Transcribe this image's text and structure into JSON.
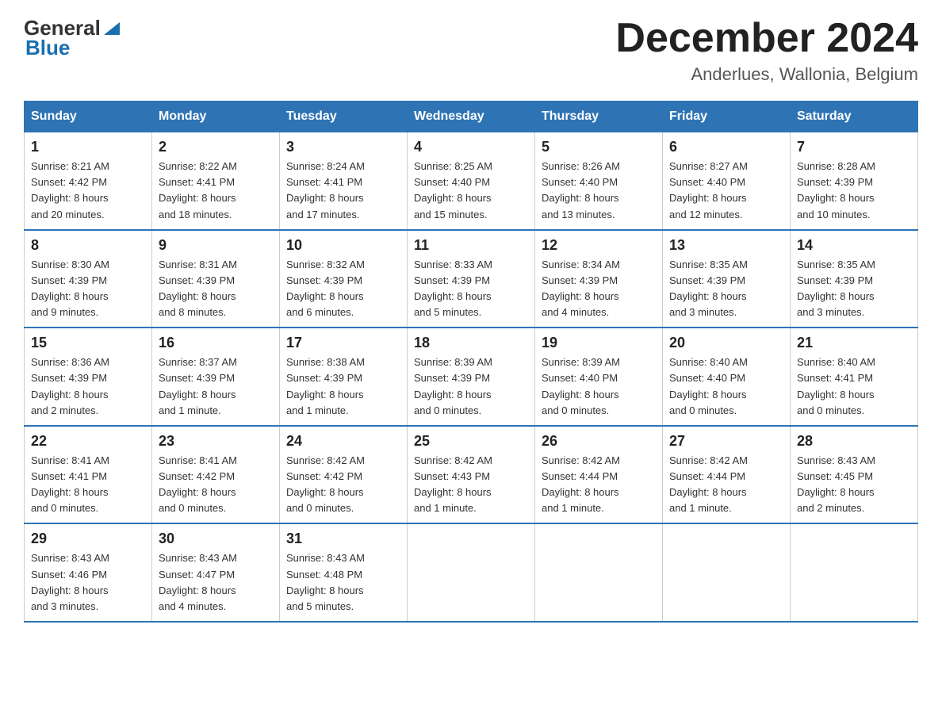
{
  "header": {
    "logo": {
      "general": "General",
      "blue": "Blue"
    },
    "title": "December 2024",
    "location": "Anderlues, Wallonia, Belgium"
  },
  "days_of_week": [
    "Sunday",
    "Monday",
    "Tuesday",
    "Wednesday",
    "Thursday",
    "Friday",
    "Saturday"
  ],
  "weeks": [
    [
      {
        "day": "1",
        "sunrise": "8:21 AM",
        "sunset": "4:42 PM",
        "daylight": "8 hours and 20 minutes."
      },
      {
        "day": "2",
        "sunrise": "8:22 AM",
        "sunset": "4:41 PM",
        "daylight": "8 hours and 18 minutes."
      },
      {
        "day": "3",
        "sunrise": "8:24 AM",
        "sunset": "4:41 PM",
        "daylight": "8 hours and 17 minutes."
      },
      {
        "day": "4",
        "sunrise": "8:25 AM",
        "sunset": "4:40 PM",
        "daylight": "8 hours and 15 minutes."
      },
      {
        "day": "5",
        "sunrise": "8:26 AM",
        "sunset": "4:40 PM",
        "daylight": "8 hours and 13 minutes."
      },
      {
        "day": "6",
        "sunrise": "8:27 AM",
        "sunset": "4:40 PM",
        "daylight": "8 hours and 12 minutes."
      },
      {
        "day": "7",
        "sunrise": "8:28 AM",
        "sunset": "4:39 PM",
        "daylight": "8 hours and 10 minutes."
      }
    ],
    [
      {
        "day": "8",
        "sunrise": "8:30 AM",
        "sunset": "4:39 PM",
        "daylight": "8 hours and 9 minutes."
      },
      {
        "day": "9",
        "sunrise": "8:31 AM",
        "sunset": "4:39 PM",
        "daylight": "8 hours and 8 minutes."
      },
      {
        "day": "10",
        "sunrise": "8:32 AM",
        "sunset": "4:39 PM",
        "daylight": "8 hours and 6 minutes."
      },
      {
        "day": "11",
        "sunrise": "8:33 AM",
        "sunset": "4:39 PM",
        "daylight": "8 hours and 5 minutes."
      },
      {
        "day": "12",
        "sunrise": "8:34 AM",
        "sunset": "4:39 PM",
        "daylight": "8 hours and 4 minutes."
      },
      {
        "day": "13",
        "sunrise": "8:35 AM",
        "sunset": "4:39 PM",
        "daylight": "8 hours and 3 minutes."
      },
      {
        "day": "14",
        "sunrise": "8:35 AM",
        "sunset": "4:39 PM",
        "daylight": "8 hours and 3 minutes."
      }
    ],
    [
      {
        "day": "15",
        "sunrise": "8:36 AM",
        "sunset": "4:39 PM",
        "daylight": "8 hours and 2 minutes."
      },
      {
        "day": "16",
        "sunrise": "8:37 AM",
        "sunset": "4:39 PM",
        "daylight": "8 hours and 1 minute."
      },
      {
        "day": "17",
        "sunrise": "8:38 AM",
        "sunset": "4:39 PM",
        "daylight": "8 hours and 1 minute."
      },
      {
        "day": "18",
        "sunrise": "8:39 AM",
        "sunset": "4:39 PM",
        "daylight": "8 hours and 0 minutes."
      },
      {
        "day": "19",
        "sunrise": "8:39 AM",
        "sunset": "4:40 PM",
        "daylight": "8 hours and 0 minutes."
      },
      {
        "day": "20",
        "sunrise": "8:40 AM",
        "sunset": "4:40 PM",
        "daylight": "8 hours and 0 minutes."
      },
      {
        "day": "21",
        "sunrise": "8:40 AM",
        "sunset": "4:41 PM",
        "daylight": "8 hours and 0 minutes."
      }
    ],
    [
      {
        "day": "22",
        "sunrise": "8:41 AM",
        "sunset": "4:41 PM",
        "daylight": "8 hours and 0 minutes."
      },
      {
        "day": "23",
        "sunrise": "8:41 AM",
        "sunset": "4:42 PM",
        "daylight": "8 hours and 0 minutes."
      },
      {
        "day": "24",
        "sunrise": "8:42 AM",
        "sunset": "4:42 PM",
        "daylight": "8 hours and 0 minutes."
      },
      {
        "day": "25",
        "sunrise": "8:42 AM",
        "sunset": "4:43 PM",
        "daylight": "8 hours and 1 minute."
      },
      {
        "day": "26",
        "sunrise": "8:42 AM",
        "sunset": "4:44 PM",
        "daylight": "8 hours and 1 minute."
      },
      {
        "day": "27",
        "sunrise": "8:42 AM",
        "sunset": "4:44 PM",
        "daylight": "8 hours and 1 minute."
      },
      {
        "day": "28",
        "sunrise": "8:43 AM",
        "sunset": "4:45 PM",
        "daylight": "8 hours and 2 minutes."
      }
    ],
    [
      {
        "day": "29",
        "sunrise": "8:43 AM",
        "sunset": "4:46 PM",
        "daylight": "8 hours and 3 minutes."
      },
      {
        "day": "30",
        "sunrise": "8:43 AM",
        "sunset": "4:47 PM",
        "daylight": "8 hours and 4 minutes."
      },
      {
        "day": "31",
        "sunrise": "8:43 AM",
        "sunset": "4:48 PM",
        "daylight": "8 hours and 5 minutes."
      },
      null,
      null,
      null,
      null
    ]
  ],
  "labels": {
    "sunrise": "Sunrise:",
    "sunset": "Sunset:",
    "daylight": "Daylight:"
  }
}
